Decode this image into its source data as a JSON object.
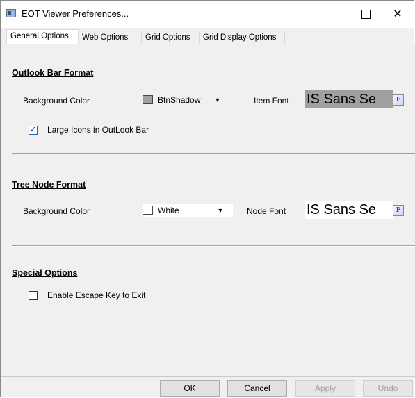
{
  "window": {
    "title": "EOT Viewer Preferences...",
    "minimize_glyph": "—",
    "close_glyph": "✕",
    "icon": "app-window-icon"
  },
  "tabs": [
    {
      "label": "General Options",
      "active": true
    },
    {
      "label": "Web Options",
      "active": false
    },
    {
      "label": "Grid Options",
      "active": false
    },
    {
      "label": "Grid Display Options",
      "active": false
    }
  ],
  "outlook_bar": {
    "title": "Outlook Bar Format",
    "bg_label": "Background Color",
    "bg_value": "BtnShadow",
    "bg_swatch": "#a0a0a0",
    "font_label": "Item Font",
    "font_preview": "IS Sans Se",
    "font_preview_bg": "#a0a0a0",
    "large_icons_label": "Large Icons in OutLook Bar",
    "large_icons_checked": true
  },
  "tree_node": {
    "title": "Tree Node Format",
    "bg_label": "Background Color",
    "bg_value": "White",
    "bg_swatch": "#ffffff",
    "font_label": "Node Font",
    "font_preview": "IS Sans Se",
    "font_preview_bg": "#ffffff"
  },
  "special": {
    "title": "Special Options",
    "escape_label": "Enable Escape Key to Exit",
    "escape_checked": false
  },
  "buttons": {
    "ok": "OK",
    "cancel": "Cancel",
    "apply": "Apply",
    "undo": "Undo"
  },
  "icons": {
    "dropdown": "▼",
    "font_button": "font-picker-icon"
  }
}
